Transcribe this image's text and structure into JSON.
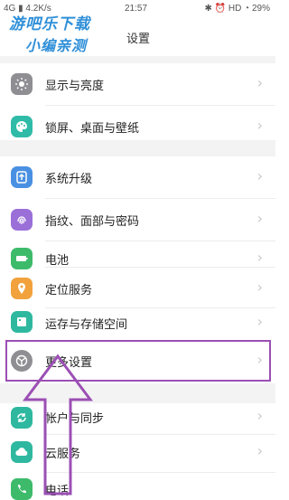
{
  "status_bar": {
    "network": "4G",
    "signal": "▮",
    "speed": "4.2K/s",
    "time": "21:57",
    "right": "✱ ⏰ HD ◔ 29%"
  },
  "watermark": {
    "line1": "游吧乐下载",
    "line2": "小编亲测"
  },
  "header": {
    "title": "设置"
  },
  "rows": [
    {
      "key": "display",
      "label": "显示与亮度",
      "icon": "sun-icon",
      "color": "#8e8e93"
    },
    {
      "key": "lockscreen",
      "label": "锁屏、桌面与壁纸",
      "icon": "palette-icon",
      "color": "#2fbba8"
    },
    {
      "key": "update",
      "label": "系统升级",
      "icon": "upgrade-icon",
      "color": "#4a90e2"
    },
    {
      "key": "fingerprint",
      "label": "指纹、面部与密码",
      "icon": "fingerprint-icon",
      "color": "#9a6fd8"
    },
    {
      "key": "battery",
      "label": "电池",
      "icon": "battery-icon",
      "color": "#3dbb6b"
    },
    {
      "key": "location",
      "label": "定位服务",
      "icon": "location-icon",
      "color": "#f2a23c"
    },
    {
      "key": "storage",
      "label": "运存与存储空间",
      "icon": "storage-icon",
      "color": "#2fb8a0"
    },
    {
      "key": "more",
      "label": "更多设置",
      "icon": "gear-icon",
      "color": "#8e8e93"
    },
    {
      "key": "account",
      "label": "帐户与同步",
      "icon": "sync-icon",
      "color": "#2fb8a0"
    },
    {
      "key": "cloud",
      "label": "云服务",
      "icon": "cloud-icon",
      "color": "#2fb8a0"
    },
    {
      "key": "phone",
      "label": "电话",
      "icon": "phone-icon",
      "color": "#3dbb6b"
    }
  ],
  "colors": {
    "annotation": "#9b4fb4"
  }
}
